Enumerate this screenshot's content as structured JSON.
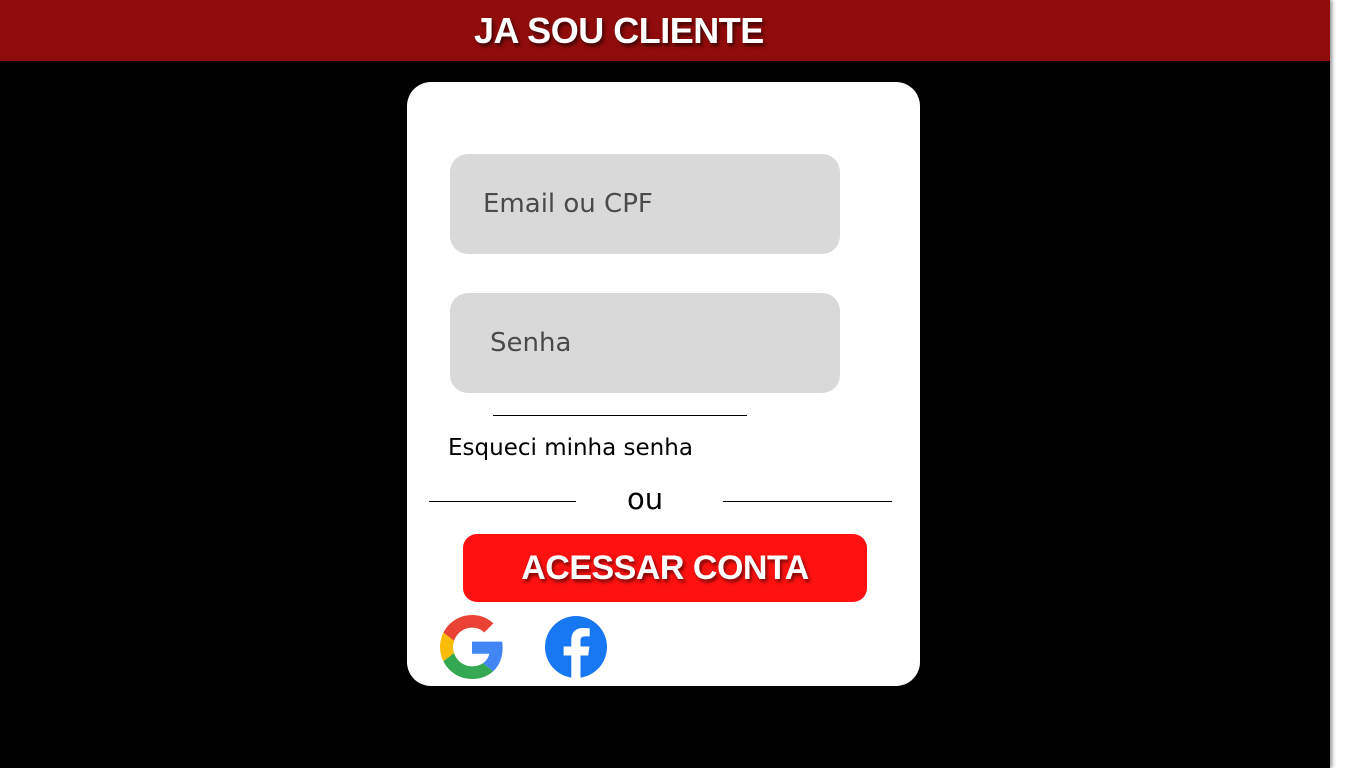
{
  "header": {
    "title": "JA SOU CLIENTE"
  },
  "login_form": {
    "email_placeholder": "Email ou CPF",
    "password_placeholder": "Senha",
    "forgot_password_label": "Esqueci minha senha",
    "divider_label": "ou",
    "submit_label": "ACESSAR CONTA",
    "social_logins": [
      {
        "name": "google",
        "icon": "google-icon"
      },
      {
        "name": "facebook",
        "icon": "facebook-icon"
      }
    ]
  },
  "colors": {
    "header_bg": "#900b0b",
    "page_bg": "#000000",
    "card_bg": "#ffffff",
    "field_bg": "#d9d9d9",
    "button_bg": "#fe1111",
    "facebook_blue": "#1877f2"
  }
}
